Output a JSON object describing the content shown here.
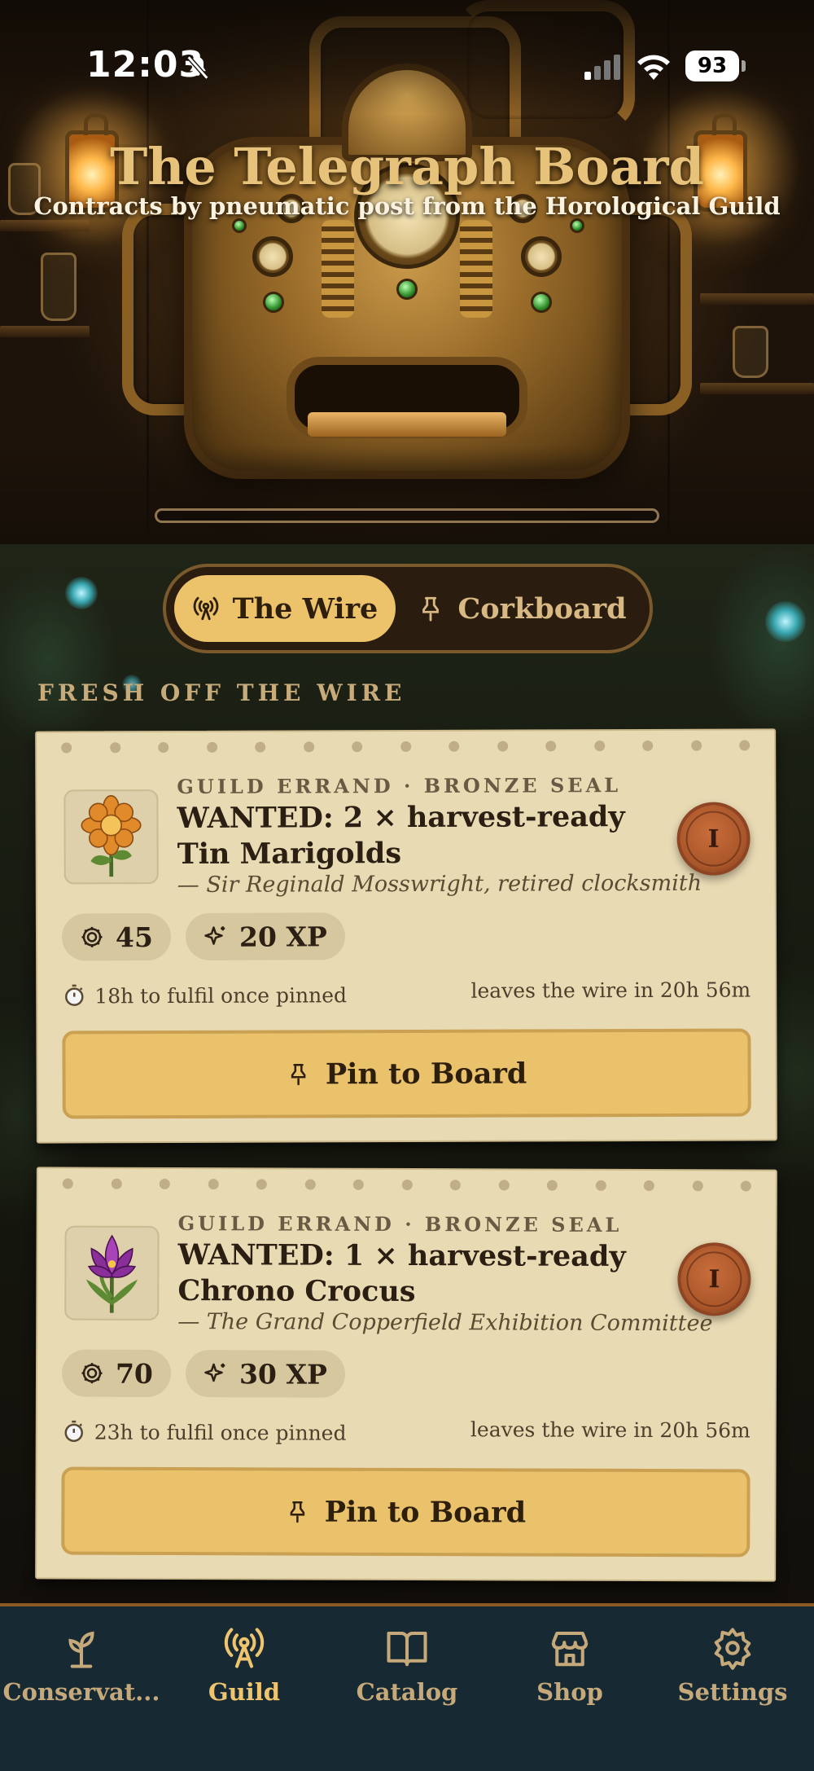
{
  "status_bar": {
    "time": "12:03",
    "battery": "93"
  },
  "header": {
    "title": "The Telegraph Board",
    "subtitle": "Contracts by pneumatic post from the Horological Guild"
  },
  "toggle": {
    "wire_label": "The Wire",
    "corkboard_label": "Corkboard"
  },
  "section_heading": "FRESH OFF THE WIRE",
  "contracts": [
    {
      "errand": "GUILD ERRAND · BRONZE SEAL",
      "title": "WANTED: 2 × harvest-ready Tin Marigolds",
      "client": "— Sir Reginald Mosswright, retired clocksmith",
      "tier": "I",
      "coins": "45",
      "xp": "20 XP",
      "fulfil": "18h to fulfil once pinned",
      "expires": "leaves the wire in 20h 56m",
      "button": "Pin to Board",
      "flower_icon": "marigold-icon",
      "flower_color": "#e08a2a"
    },
    {
      "errand": "GUILD ERRAND · BRONZE SEAL",
      "title": "WANTED: 1 × harvest-ready Chrono Crocus",
      "client": "— The Grand Copperfield Exhibition Committee",
      "tier": "I",
      "coins": "70",
      "xp": "30 XP",
      "fulfil": "23h to fulfil once pinned",
      "expires": "leaves the wire in 20h 56m",
      "button": "Pin to Board",
      "flower_icon": "crocus-icon",
      "flower_color": "#8a2f9a"
    }
  ],
  "tabs": [
    {
      "label": "Conservat...",
      "icon": "sprout-icon",
      "active": false
    },
    {
      "label": "Guild",
      "icon": "antenna-icon",
      "active": true
    },
    {
      "label": "Catalog",
      "icon": "book-icon",
      "active": false
    },
    {
      "label": "Shop",
      "icon": "store-icon",
      "active": false
    },
    {
      "label": "Settings",
      "icon": "gear-icon",
      "active": false
    }
  ],
  "colors": {
    "accent": "#ecc26a",
    "paper": "#e8dab3",
    "tabbar": "#172a33",
    "seal": "#b85c2e"
  }
}
